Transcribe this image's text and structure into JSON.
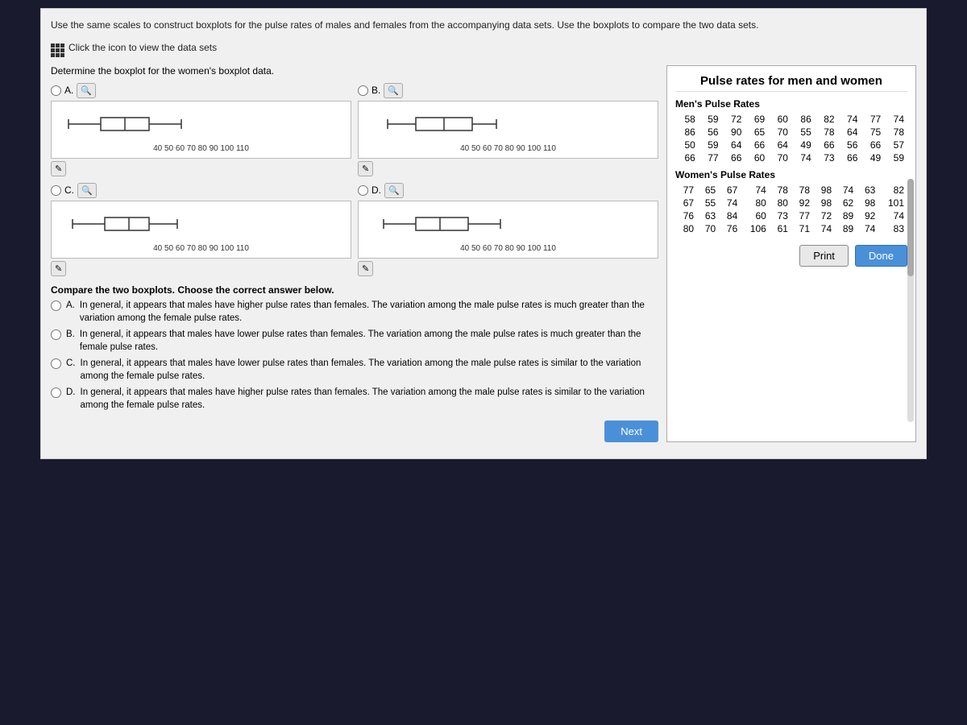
{
  "instruction": "Use the same scales to construct boxplots for the pulse rates of males and females from the accompanying data sets. Use the boxplots to compare the two data sets.",
  "data_sets_link": "Click the icon to view the data sets",
  "determine_label": "Determine the boxplot for the women's boxplot data.",
  "axis_labels": {
    "a": "40 50 60 70 80 90 100 110",
    "b": "40 50 60 70 80 90 100 110",
    "c": "40 50 60 70 80 90 100 110",
    "d": "40 50 60 70 80 90 100 110"
  },
  "options": {
    "a": "A.",
    "b": "B.",
    "c": "C.",
    "d": "D."
  },
  "panel_title": "Pulse rates for men and women",
  "mens_section_title": "Men's Pulse Rates",
  "mens_data": [
    [
      58,
      59,
      72,
      69,
      60,
      86,
      82,
      74,
      77,
      74
    ],
    [
      86,
      56,
      90,
      65,
      70,
      55,
      78,
      64,
      75,
      78
    ],
    [
      50,
      59,
      64,
      66,
      64,
      49,
      66,
      56,
      66,
      57
    ],
    [
      66,
      77,
      66,
      60,
      70,
      74,
      73,
      66,
      49,
      59
    ]
  ],
  "womens_section_title": "Women's Pulse Rates",
  "womens_data": [
    [
      77,
      65,
      67,
      74,
      78,
      78,
      98,
      74,
      63,
      82
    ],
    [
      67,
      55,
      74,
      80,
      80,
      92,
      98,
      62,
      98,
      101
    ],
    [
      76,
      63,
      84,
      60,
      73,
      77,
      72,
      89,
      92,
      74
    ],
    [
      80,
      70,
      76,
      106,
      61,
      71,
      74,
      89,
      74,
      83
    ]
  ],
  "print_label": "Print",
  "done_label": "Done",
  "compare_title": "Compare the two boxplots. Choose the correct answer below.",
  "compare_options": [
    {
      "id": "A",
      "text": "In general, it appears that males have higher pulse rates than females. The variation among the male pulse rates is much greater than the variation among the female pulse rates."
    },
    {
      "id": "B",
      "text": "In general, it appears that males have lower pulse rates than females. The variation among the male pulse rates is much greater than the female pulse rates."
    },
    {
      "id": "C",
      "text": "In general, it appears that males have lower pulse rates than females. The variation among the male pulse rates is similar to the variation among the female pulse rates."
    },
    {
      "id": "D",
      "text": "In general, it appears that males have higher pulse rates than females. The variation among the male pulse rates is similar to the variation among the female pulse rates."
    }
  ],
  "next_label": "Next"
}
